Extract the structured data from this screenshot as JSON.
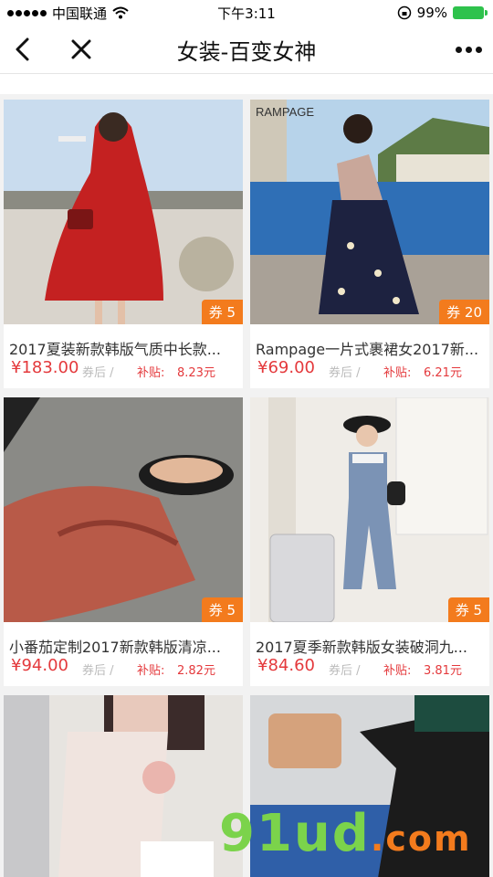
{
  "status_bar": {
    "carrier": "中国联通",
    "time": "下午3:11",
    "battery": "99%"
  },
  "nav": {
    "back_icon": "back-arrow-icon",
    "close_icon": "close-icon",
    "title": "女装-百变女神",
    "more_icon": "more-dots-icon"
  },
  "products": [
    {
      "title": "2017夏装新款韩版气质中长款...",
      "price": "¥183.00",
      "after": "券后 /",
      "subsidy_label": "补贴:",
      "subsidy": "8.23元",
      "coupon": "券 5"
    },
    {
      "title": "Rampage一片式裹裙女2017新...",
      "price": "¥69.00",
      "after": "券后 /",
      "subsidy_label": "补贴:",
      "subsidy": "6.21元",
      "coupon": "券 20"
    },
    {
      "title": "小番茄定制2017新款韩版清凉...",
      "price": "¥94.00",
      "after": "券后 /",
      "subsidy_label": "补贴:",
      "subsidy": "2.82元",
      "coupon": "券 5"
    },
    {
      "title": "2017夏季新款韩版女装破洞九...",
      "price": "¥84.60",
      "after": "券后 /",
      "subsidy_label": "补贴:",
      "subsidy": "3.81元",
      "coupon": "券 5"
    }
  ],
  "photo_text": {
    "brand": "RAMPAGE"
  },
  "watermark": {
    "main": "91ud",
    "suffix": ".com"
  }
}
